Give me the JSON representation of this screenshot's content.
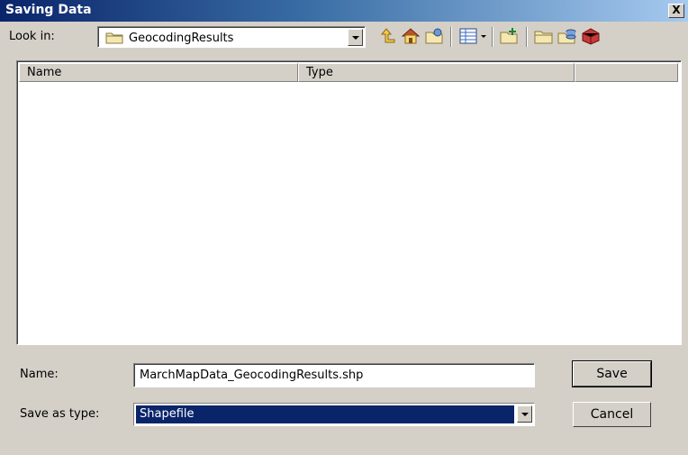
{
  "window": {
    "title": "Saving Data",
    "close_label": "X"
  },
  "lookin": {
    "label": "Look in:",
    "value": "GeocodingResults"
  },
  "toolbar": {
    "icons": [
      "up-one-level-icon",
      "home-icon",
      "connect-folder-icon",
      "view-menu-icon",
      "new-folder-icon",
      "folder-icon",
      "geodatabase-icon",
      "toolbox-icon"
    ]
  },
  "list": {
    "columns": [
      "Name",
      "Type",
      ""
    ]
  },
  "name": {
    "label": "Name:",
    "value": "MarchMapData_GeocodingResults.shp"
  },
  "savetype": {
    "label": "Save as type:",
    "value": "Shapefile"
  },
  "buttons": {
    "save": "Save",
    "cancel": "Cancel"
  },
  "colors": {
    "title_start": "#0a246a",
    "title_end": "#a6caf0",
    "dialog_bg": "#d4d0c8",
    "selection": "#0a246a"
  }
}
